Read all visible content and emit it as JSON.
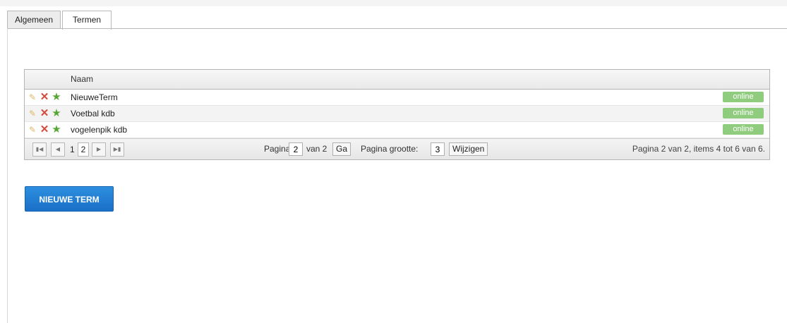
{
  "tabs": [
    {
      "label": "Algemeen"
    },
    {
      "label": "Termen"
    }
  ],
  "grid": {
    "header": {
      "name_col": "Naam"
    },
    "rows": [
      {
        "name": "NieuweTerm",
        "status": "online"
      },
      {
        "name": "Voetbal kdb",
        "status": "online"
      },
      {
        "name": "vogelenpik kdb",
        "status": "online"
      }
    ],
    "row_icons": [
      "edit-icon",
      "delete-icon",
      "star-icon"
    ],
    "status_color": "#8fcc7e"
  },
  "pager": {
    "pages": [
      "1",
      "2"
    ],
    "current_page": "2",
    "page_label": "Pagina:",
    "page_input": "2",
    "of_label": "van 2",
    "go_label": "Ga",
    "size_label": "Pagina grootte:",
    "size_input": "3",
    "change_label": "Wijzigen",
    "info": "Pagina 2 van 2, items 4 tot 6 van 6."
  },
  "actions": {
    "new_term": "NIEUWE TERM"
  },
  "colors": {
    "accent": "#1a6fc6"
  }
}
